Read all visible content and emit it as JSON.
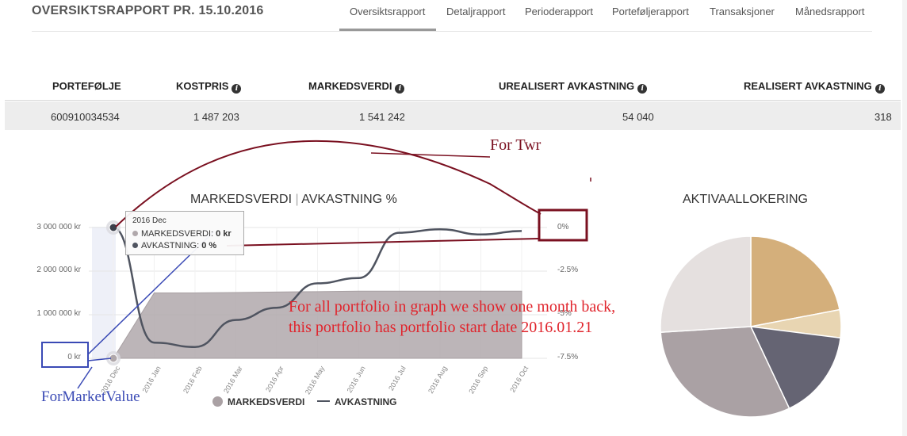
{
  "header": {
    "title": "OVERSIKTSRAPPORT PR. 15.10.2016",
    "tabs": [
      {
        "label": "Oversiktsrapport",
        "active": true
      },
      {
        "label": "Detaljrapport",
        "active": false
      },
      {
        "label": "Perioderapport",
        "active": false
      },
      {
        "label": "Porteføljerapport",
        "active": false
      },
      {
        "label": "Transaksjoner",
        "active": false
      },
      {
        "label": "Månedsrapport",
        "active": false
      }
    ]
  },
  "table": {
    "columns": [
      "PORTEFØLJE",
      "KOSTPRIS",
      "MARKEDSVERDI",
      "UREALISERT AVKASTNING",
      "REALISERT AVKASTNING"
    ],
    "rows": [
      [
        "600910034534",
        "1 487 203",
        "1 541 242",
        "54 040",
        "318"
      ]
    ]
  },
  "chart_title": {
    "left": "MARKEDSVERDI",
    "separator": "|",
    "right": "AVKASTNING %"
  },
  "legend": {
    "marketvalue": "MARKEDSVERDI",
    "return": "AVKASTNING"
  },
  "tooltip": {
    "date": "2016 Dec",
    "mv_label": "MARKEDSVERDI:",
    "mv_value": "0 kr",
    "ret_label": "AVKASTNING:",
    "ret_value": "0 %"
  },
  "annotations": {
    "twr": "For Twr",
    "main": "For all portfolio in graph we show one month back, this portfolio has portfolio start date 2016.01.21",
    "market_value": "ForMarketValue"
  },
  "allocation_title": "AKTIVAALLOKERING",
  "colors": {
    "market_area": "#b0a8ab",
    "return_line": "#4f5460",
    "annotation_dark_red": "#7a1020",
    "annotation_red": "#e0242c",
    "annotation_blue": "#3a4ab5"
  },
  "chart_data": [
    {
      "type": "line",
      "title": "MARKEDSVERDI | AVKASTNING %",
      "categories": [
        "2016 Dec",
        "2016 Jan",
        "2016 Feb",
        "2016 Mar",
        "2016 Apr",
        "2016 May",
        "2016 Jun",
        "2016 Jul",
        "2016 Aug",
        "2016 Sep",
        "2016 Oct"
      ],
      "series": [
        {
          "name": "MARKEDSVERDI",
          "kind": "area",
          "axis": "left",
          "values": [
            0,
            1500000,
            1500000,
            1510000,
            1520000,
            1530000,
            1540000,
            1540000,
            1540000,
            1540000,
            1541242
          ]
        },
        {
          "name": "AVKASTNING",
          "kind": "line",
          "axis": "right",
          "values": [
            0,
            -6.6,
            -6.85,
            -5.3,
            -4.6,
            -3.2,
            -2.9,
            -0.3,
            -0.1,
            -0.4,
            -0.2
          ]
        }
      ],
      "y_left": {
        "ticks": [
          "3 000 000 kr",
          "2 000 000 kr",
          "1 000 000 kr",
          "0 kr"
        ],
        "range": [
          0,
          3000000
        ]
      },
      "y_right": {
        "ticks": [
          "0%",
          "-2.5%",
          "-5%",
          "-7.5%"
        ],
        "range": [
          -7.5,
          0
        ]
      }
    },
    {
      "type": "pie",
      "title": "AKTIVAALLOKERING",
      "slices": [
        {
          "value": 22,
          "color": "#d4af7b"
        },
        {
          "value": 5,
          "color": "#e8d5b2"
        },
        {
          "value": 16,
          "color": "#656473"
        },
        {
          "value": 31,
          "color": "#aaa1a4"
        },
        {
          "value": 26,
          "color": "#e5e0df"
        }
      ]
    }
  ]
}
